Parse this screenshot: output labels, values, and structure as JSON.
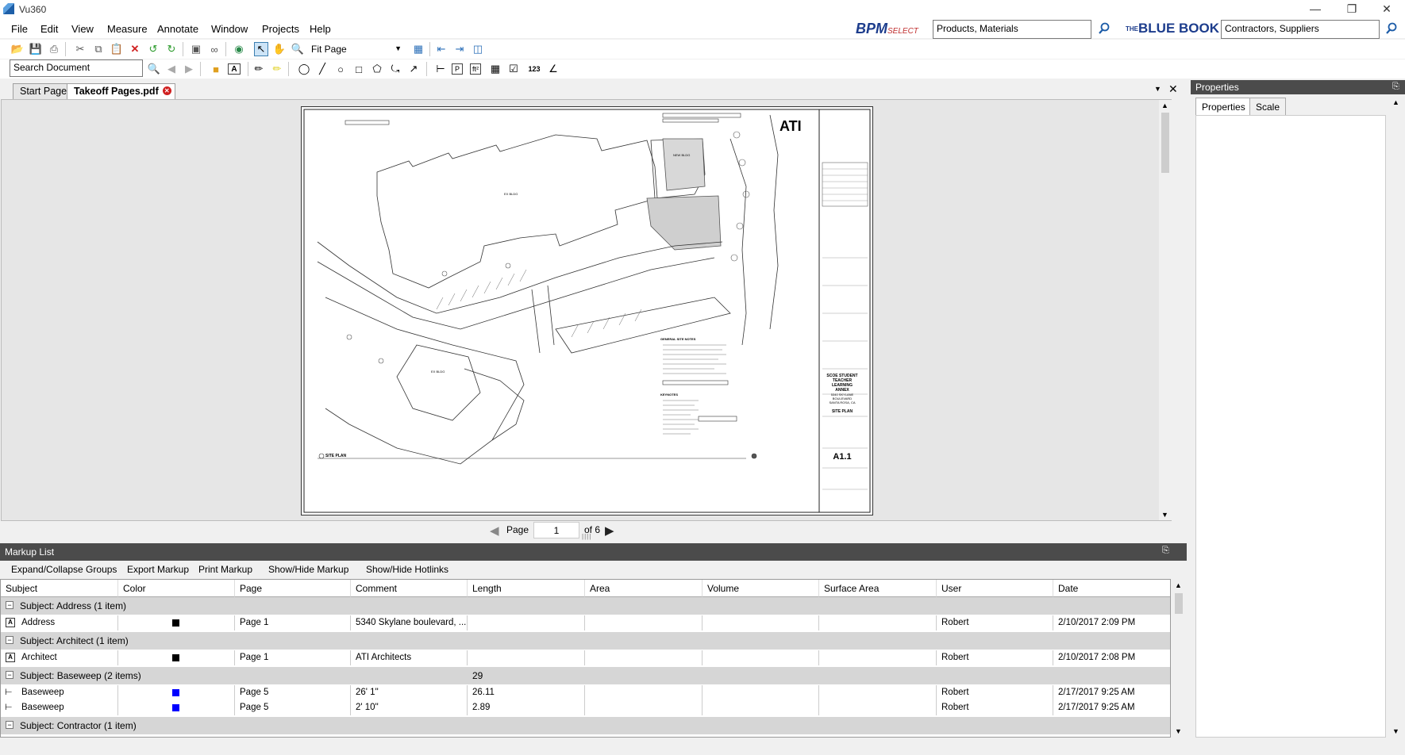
{
  "app": {
    "title": "Vu360"
  },
  "menu": [
    "File",
    "Edit",
    "View",
    "Measure",
    "Annotate",
    "Window",
    "Projects",
    "Help"
  ],
  "search_bpm": {
    "brand_main": "BPM",
    "brand_sub": "SELECT",
    "value": "Products, Materials"
  },
  "search_bluebook": {
    "brand": "BLUE BOOK",
    "brand_prefix": "THE",
    "value": "Contractors, Suppliers"
  },
  "toolbar": {
    "zoom_mode": "Fit Page",
    "search_doc_value": "Search Document",
    "count_label": "123"
  },
  "tabs": [
    {
      "label": "Start Page"
    },
    {
      "label": "Takeoff Pages.pdf"
    }
  ],
  "drawing": {
    "logo": "ATI",
    "project_lines": [
      "SCOE STUDENT",
      "TEACHER",
      "LEARNING",
      "ANNEX",
      "5340 SKYLANE",
      "BOULEVARD",
      "SANTA ROSA, CA"
    ],
    "sheet_title": "SITE PLAN",
    "sheet_number": "A1.1",
    "plan_label": "SITE PLAN",
    "bldg_existing": "EX BLDG",
    "bldg_new": "NEW BLDG",
    "bldg_c": "EX BLDG",
    "notes_title": "GENERAL SITE NOTES",
    "keynotes_title": "KEYNOTES"
  },
  "pagenav": {
    "label": "Page",
    "current": "1",
    "of": "of 6"
  },
  "markup": {
    "title": "Markup List",
    "actions": [
      "Expand/Collapse Groups",
      "Export Markup",
      "Print Markup",
      "Show/Hide Markup",
      "Show/Hide Hotlinks"
    ],
    "columns": [
      "Subject",
      "Color",
      "Page",
      "Comment",
      "Length",
      "Area",
      "Volume",
      "Surface Area",
      "User",
      "Date"
    ],
    "groups": [
      {
        "label": "Subject: Address (1 item)",
        "length_total": "",
        "rows": [
          {
            "subject": "Address",
            "color": "#000000",
            "page": "Page 1",
            "comment": "5340 Skylane boulevard, ...",
            "length": "",
            "user": "Robert",
            "date": "2/10/2017 2:09 PM"
          }
        ]
      },
      {
        "label": "Subject: Architect (1 item)",
        "length_total": "",
        "rows": [
          {
            "subject": "Architect",
            "color": "#000000",
            "page": "Page 1",
            "comment": "ATI Architects",
            "length": "",
            "user": "Robert",
            "date": "2/10/2017 2:08 PM"
          }
        ]
      },
      {
        "label": "Subject: Baseweep (2 items)",
        "length_total": "29",
        "rows": [
          {
            "subject": "Baseweep",
            "color": "#0000ff",
            "page": "Page 5",
            "comment": "26' 1\"",
            "length": "26.11",
            "user": "Robert",
            "date": "2/17/2017 9:25 AM"
          },
          {
            "subject": "Baseweep",
            "color": "#0000ff",
            "page": "Page 5",
            "comment": "2' 10\"",
            "length": "2.89",
            "user": "Robert",
            "date": "2/17/2017 9:25 AM"
          }
        ]
      },
      {
        "label": "Subject: Contractor (1 item)",
        "length_total": "",
        "rows": []
      }
    ]
  },
  "properties": {
    "title": "Properties",
    "tabs": [
      "Properties",
      "Scale"
    ]
  }
}
